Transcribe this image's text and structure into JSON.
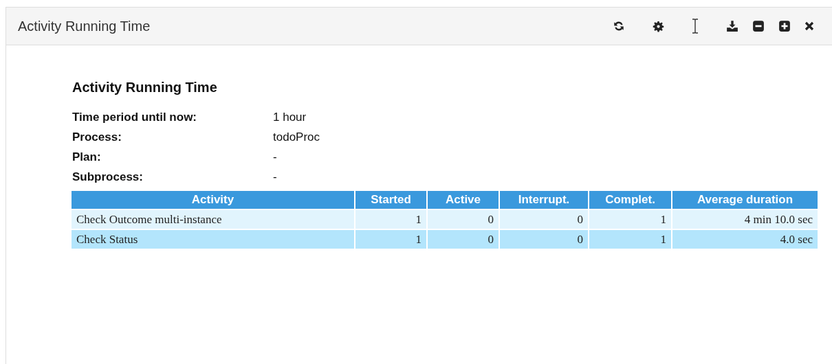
{
  "window": {
    "title": "Activity Running Time"
  },
  "report": {
    "title": "Activity Running Time",
    "fields": [
      {
        "label": "Time period until now:",
        "value": "1 hour"
      },
      {
        "label": "Process:",
        "value": "todoProc"
      },
      {
        "label": "Plan:",
        "value": "-"
      },
      {
        "label": "Subprocess:",
        "value": "-"
      }
    ],
    "table": {
      "columns": [
        "Activity",
        "Started",
        "Active",
        "Interrupt.",
        "Complet.",
        "Average duration"
      ],
      "rows": [
        [
          "Check Outcome multi-instance",
          "1",
          "0",
          "0",
          "1",
          "4 min 10.0 sec"
        ],
        [
          "Check Status",
          "1",
          "0",
          "0",
          "1",
          "4.0 sec"
        ]
      ]
    }
  }
}
